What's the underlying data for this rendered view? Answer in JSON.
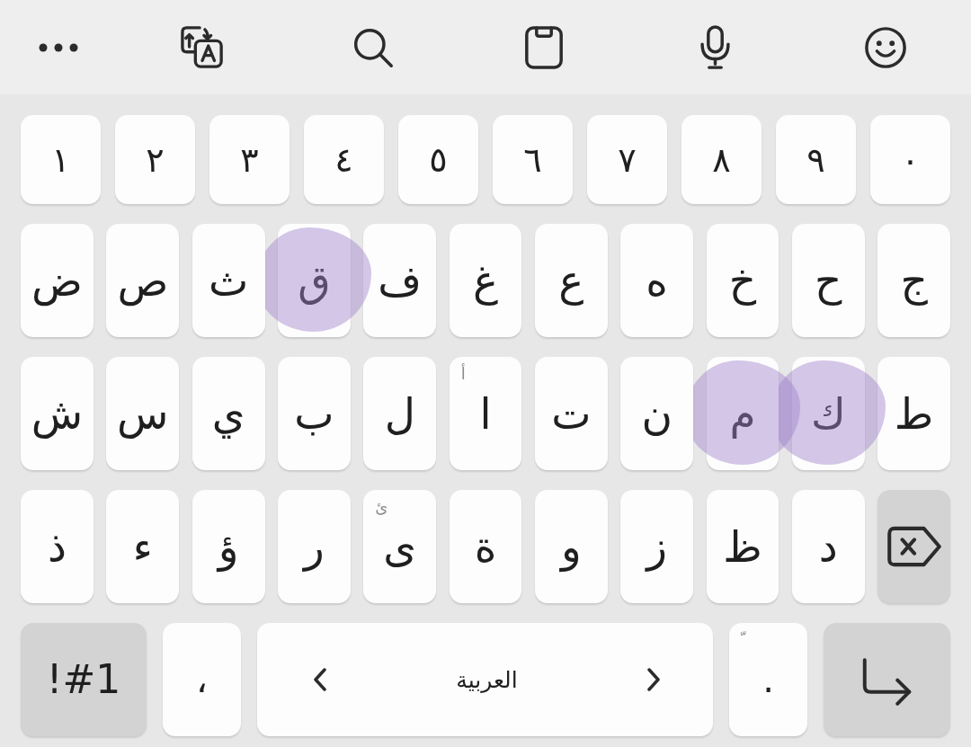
{
  "toolbar": {
    "buttons": [
      {
        "kind": "more"
      },
      {
        "kind": "translate"
      },
      {
        "kind": "search"
      },
      {
        "kind": "clipboard"
      },
      {
        "kind": "mic"
      },
      {
        "kind": "emoji"
      }
    ]
  },
  "keyboard": {
    "rows": [
      {
        "keys": [
          {
            "kind": "digit",
            "label": "٠"
          },
          {
            "kind": "digit",
            "label": "٩"
          },
          {
            "kind": "digit",
            "label": "٨"
          },
          {
            "kind": "digit",
            "label": "٧"
          },
          {
            "kind": "digit",
            "label": "٦"
          },
          {
            "kind": "digit",
            "label": "٥"
          },
          {
            "kind": "digit",
            "label": "٤"
          },
          {
            "kind": "digit",
            "label": "٣"
          },
          {
            "kind": "digit",
            "label": "٢"
          },
          {
            "kind": "digit",
            "label": "١"
          }
        ]
      },
      {
        "keys": [
          {
            "kind": "letter",
            "label": "ج",
            "highlighted": false
          },
          {
            "kind": "letter",
            "label": "ح",
            "highlighted": false
          },
          {
            "kind": "letter",
            "label": "خ",
            "highlighted": false
          },
          {
            "kind": "letter",
            "label": "ه",
            "highlighted": false
          },
          {
            "kind": "letter",
            "label": "ع",
            "highlighted": false
          },
          {
            "kind": "letter",
            "label": "غ",
            "highlighted": false
          },
          {
            "kind": "letter",
            "label": "ف",
            "highlighted": false
          },
          {
            "kind": "letter",
            "label": "ق",
            "highlighted": true
          },
          {
            "kind": "letter",
            "label": "ث",
            "highlighted": false
          },
          {
            "kind": "letter",
            "label": "ص",
            "highlighted": false
          },
          {
            "kind": "letter",
            "label": "ض",
            "highlighted": false
          }
        ]
      },
      {
        "keys": [
          {
            "kind": "letter",
            "label": "ط",
            "highlighted": false
          },
          {
            "kind": "letter",
            "label": "ك",
            "highlighted": true
          },
          {
            "kind": "letter",
            "label": "م",
            "highlighted": true
          },
          {
            "kind": "letter",
            "label": "ن",
            "highlighted": false
          },
          {
            "kind": "letter",
            "label": "ت",
            "highlighted": false
          },
          {
            "kind": "letter",
            "hint": "أ",
            "label": "ا",
            "highlighted": false
          },
          {
            "kind": "letter",
            "label": "ل",
            "highlighted": false
          },
          {
            "kind": "letter",
            "label": "ب",
            "highlighted": false
          },
          {
            "kind": "letter",
            "label": "ي",
            "highlighted": false
          },
          {
            "kind": "letter",
            "label": "س",
            "highlighted": false
          },
          {
            "kind": "letter",
            "label": "ش",
            "highlighted": false
          }
        ]
      },
      {
        "keys": [
          {
            "kind": "backspace"
          },
          {
            "kind": "letter",
            "label": "د"
          },
          {
            "kind": "letter",
            "label": "ظ"
          },
          {
            "kind": "letter",
            "label": "ز"
          },
          {
            "kind": "letter",
            "label": "و"
          },
          {
            "kind": "letter",
            "label": "ة"
          },
          {
            "kind": "letter",
            "hint": "ئ",
            "label": "ى"
          },
          {
            "kind": "letter",
            "label": "ر"
          },
          {
            "kind": "letter",
            "label": "ؤ"
          },
          {
            "kind": "letter",
            "label": "ء"
          },
          {
            "kind": "letter",
            "label": "ذ"
          }
        ]
      },
      {
        "keys": [
          {
            "kind": "enter"
          },
          {
            "kind": "punctuation",
            "hint": "ﹼ",
            "label": "."
          },
          {
            "kind": "space",
            "label": "العربية"
          },
          {
            "kind": "punctuation",
            "label": "،"
          },
          {
            "kind": "symbols",
            "label": "!#1"
          }
        ]
      }
    ]
  }
}
